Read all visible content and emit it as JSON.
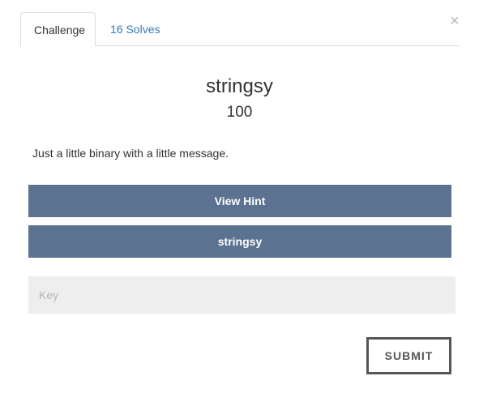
{
  "modal": {
    "close_label": "×"
  },
  "tabs": [
    {
      "label": "Challenge",
      "active": true
    },
    {
      "label": "16 Solves",
      "active": false
    }
  ],
  "challenge": {
    "title": "stringsy",
    "points": "100",
    "description": "Just a little binary with a little message.",
    "hint_button_label": "View Hint",
    "file_button_label": "stringsy"
  },
  "key_input": {
    "value": "",
    "placeholder": "Key"
  },
  "submit": {
    "label": "SUBMIT"
  },
  "colors": {
    "button_bg": "#5b7290",
    "link": "#337ab7",
    "input_bg": "#eeeeee",
    "submit_border": "#555555"
  },
  "icons": {
    "close": "close-icon"
  }
}
